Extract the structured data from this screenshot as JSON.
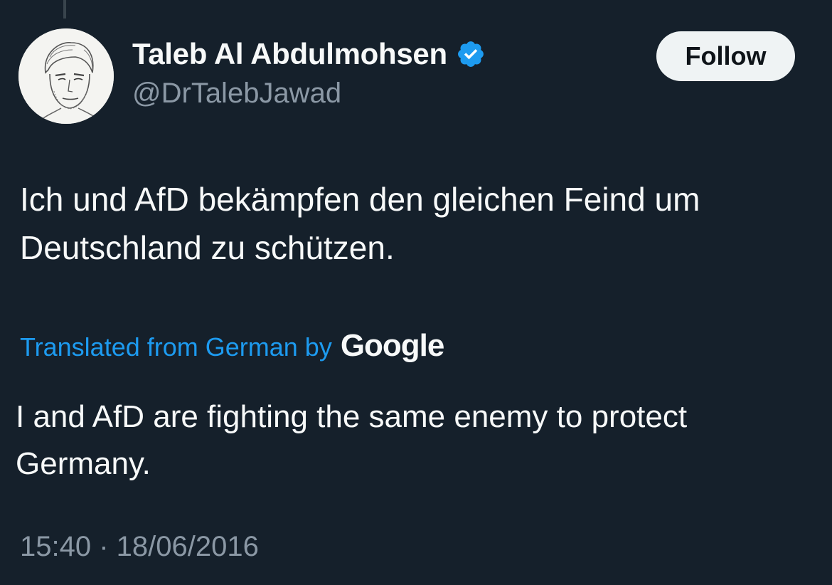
{
  "author": {
    "display_name": "Taleb Al Abdulmohsen",
    "handle": "@DrTalebJawad",
    "verified_icon": "verified-badge-icon",
    "avatar_icon": "profile-photo"
  },
  "follow_button": {
    "label": "Follow"
  },
  "tweet": {
    "original_text": "Ich und AfD bekämpfen den gleichen Feind um Deutschland zu schützen.",
    "translation_label": "Translated from German by",
    "translation_provider": "Google",
    "translated_text": "I and AfD are fighting the same enemy to protect Germany.",
    "timestamp": "15:40 · 18/06/2016"
  },
  "colors": {
    "background": "#15202b",
    "primary_text": "#f7f9f9",
    "secondary_text": "#8b98a5",
    "accent": "#1d9bf0",
    "button_bg": "#eff3f4"
  }
}
